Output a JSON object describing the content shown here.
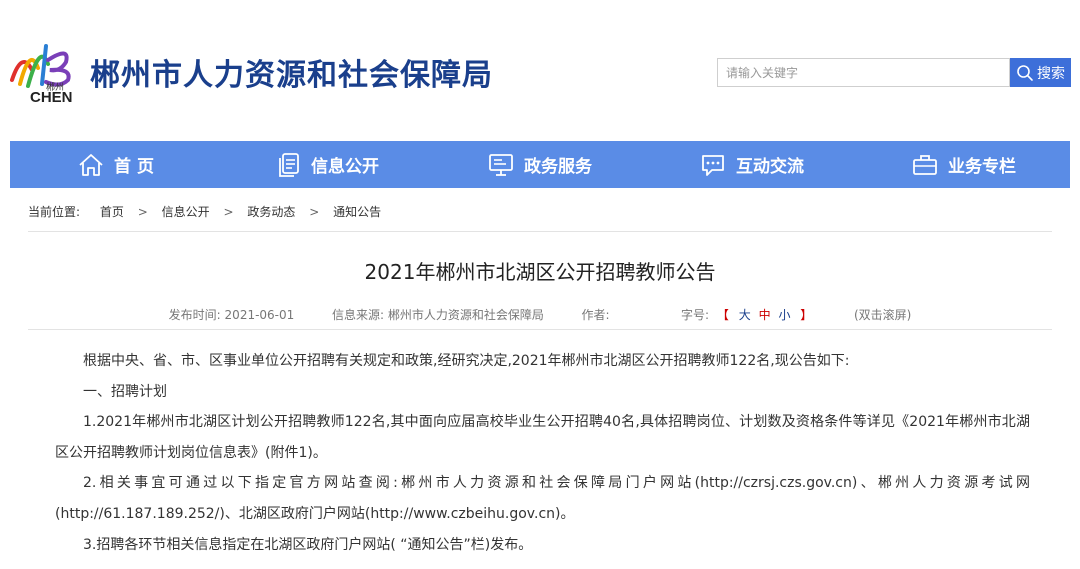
{
  "header": {
    "logo_city": "郴州",
    "logo_text": "CHEN",
    "site_title": "郴州市人力资源和社会保障局",
    "search_placeholder": "请输入关键字",
    "search_button": "搜索"
  },
  "nav": {
    "items": [
      {
        "label": "首 页",
        "icon": "home-icon"
      },
      {
        "label": "信息公开",
        "icon": "document-icon"
      },
      {
        "label": "政务服务",
        "icon": "monitor-icon"
      },
      {
        "label": "互动交流",
        "icon": "chat-icon"
      },
      {
        "label": "业务专栏",
        "icon": "briefcase-icon"
      }
    ]
  },
  "breadcrumb": {
    "lead": "当前位置:",
    "items": [
      "首页",
      "信息公开",
      "政务动态",
      "通知公告"
    ],
    "separator": ">"
  },
  "article": {
    "title": "2021年郴州市北湖区公开招聘教师公告",
    "meta": {
      "publish_label": "发布时间:",
      "publish_date": "2021-06-01",
      "source_label": "信息来源:",
      "source": "郴州市人力资源和社会保障局",
      "author_label": "作者:",
      "font_label": "字号:",
      "font_sizes": [
        "大",
        "中",
        "小"
      ],
      "scroll_hint": "(双击滚屏)"
    },
    "paragraphs": [
      "根据中央、省、市、区事业单位公开招聘有关规定和政策,经研究决定,2021年郴州市北湖区公开招聘教师122名,现公告如下:",
      "一、招聘计划",
      "1.2021年郴州市北湖区计划公开招聘教师122名,其中面向应届高校毕业生公开招聘40名,具体招聘岗位、计划数及资格条件等详见《2021年郴州市北湖区公开招聘教师计划岗位信息表》(附件1)。",
      "2.相关事宜可通过以下指定官方网站查阅:郴州市人力资源和社会保障局门户网站(http://czrsj.czs.gov.cn)、郴州人力资源考试网(http://61.187.189.252/)、北湖区政府门户网站(http://www.czbeihu.gov.cn)。",
      "3.招聘各环节相关信息指定在北湖区政府门户网站( “通知公告”栏)发布。"
    ]
  },
  "colors": {
    "brand_blue": "#1a3f8c",
    "nav_bg": "#5a8ce6",
    "search_btn": "#3d6fd9",
    "highlight_red": "#cc0000"
  }
}
